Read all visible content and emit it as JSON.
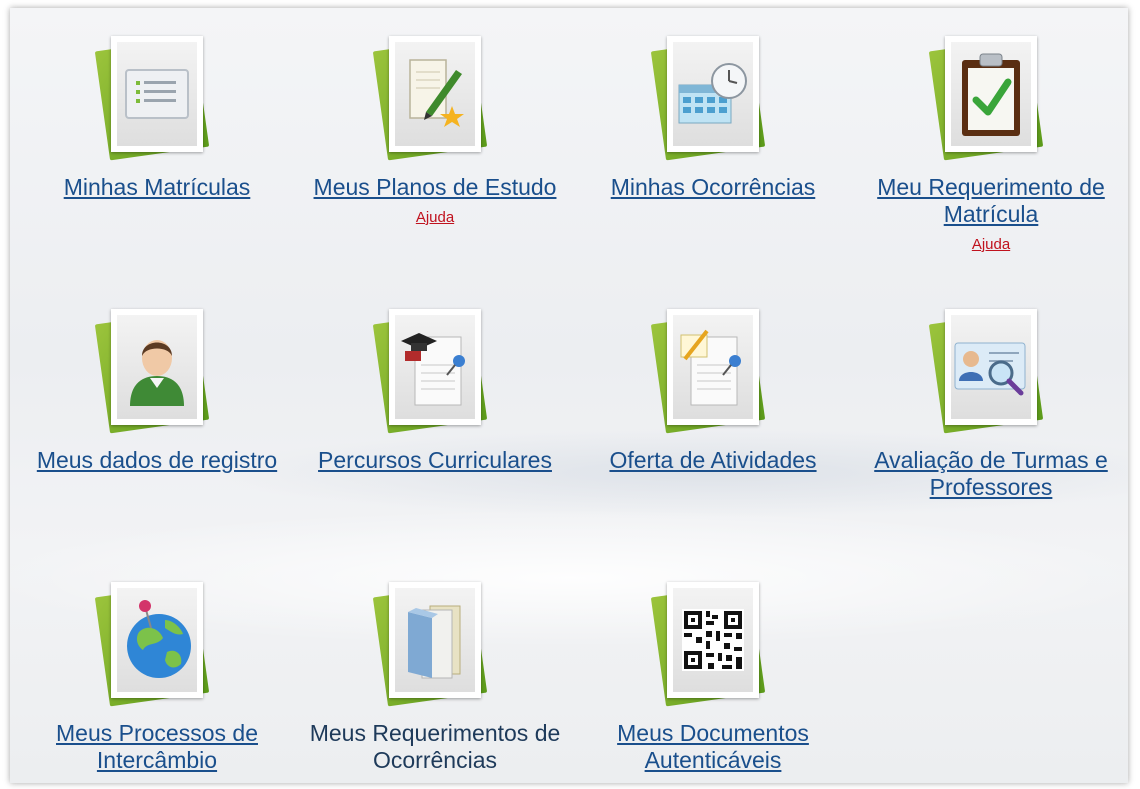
{
  "colors": {
    "link": "#1a4f8c",
    "help": "#c0121e",
    "leaf": "#7ab32e"
  },
  "tiles": [
    {
      "label": "Minhas Matrículas",
      "icon": "list-document-icon",
      "help": ""
    },
    {
      "label": "Meus Planos de Estudo",
      "icon": "notepad-pen-star-icon",
      "help": "Ajuda"
    },
    {
      "label": "Minhas Ocorrências",
      "icon": "calendar-clock-icon",
      "help": ""
    },
    {
      "label": "Meu Requerimento de Matrícula",
      "icon": "clipboard-check-icon",
      "help": "Ajuda"
    },
    {
      "label": "Meus dados de registro",
      "icon": "user-avatar-icon",
      "help": ""
    },
    {
      "label": "Percursos Curriculares",
      "icon": "graduation-document-pin-icon",
      "help": ""
    },
    {
      "label": "Oferta de Atividades",
      "icon": "document-pencil-pin-icon",
      "help": ""
    },
    {
      "label": "Avaliação de Turmas e Professores",
      "icon": "id-card-magnifier-icon",
      "help": ""
    },
    {
      "label": "Meus Processos de Intercâmbio",
      "icon": "globe-pin-icon",
      "help": ""
    },
    {
      "label": "Meus Requerimentos de Ocorrências",
      "icon": "folder-files-icon",
      "help": ""
    },
    {
      "label": "Meus Documentos Autenticáveis",
      "icon": "qr-code-icon",
      "help": ""
    }
  ]
}
